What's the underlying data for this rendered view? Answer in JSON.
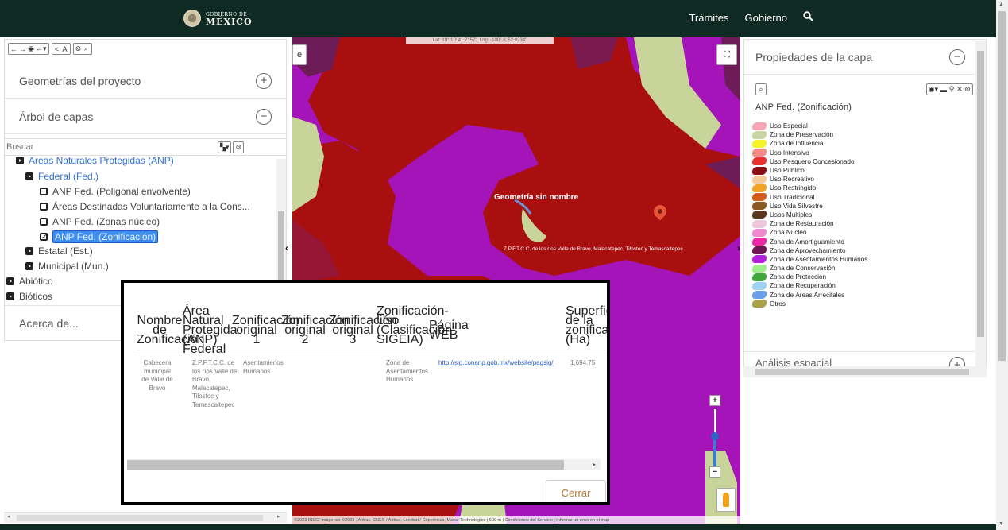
{
  "header": {
    "logo_small": "GOBIERNO DE",
    "logo_big": "MÉXICO",
    "nav": [
      "Trámites",
      "Gobierno"
    ]
  },
  "left_panel": {
    "geometrias": "Geometrías del proyecto",
    "arbol": "Árbol de capas",
    "search_placeholder": "Buscar",
    "acerca": "Acerca de...",
    "tree_top_partial": "Áreas Naturales Protegidas (ANP)",
    "tree": [
      {
        "label": "Federal (Fed.)"
      },
      {
        "label": "ANP Fed. (Poligonal envolvente)"
      },
      {
        "label": "Áreas Destinadas Voluntariamente a la Cons..."
      },
      {
        "label": "ANP Fed. (Zonas núcleo)"
      },
      {
        "label": "ANP Fed. (Zonificación)"
      },
      {
        "label": "Estatal (Est.)"
      },
      {
        "label": "Municipal (Mun.)"
      },
      {
        "label": "Abiótico"
      },
      {
        "label": "Bióticos"
      }
    ]
  },
  "map": {
    "coords": "Lat: 19° 10' 41.7157\", Lng: -100° 6' 52.0234\"",
    "geom_label": "Geometría sin nombre",
    "zone_label": "Z.P.F.T.C.C. de los ríos Valle de Bravo, Malacatepec, Tilostoc y Temascaltepec",
    "attribution": "©2023 INEGI Imágenes ©2023 , Airbus, CNES / Airbus, Landsat / Copernicus, Maxar Technologies | 500 m | Condiciones del Servicio | Informar un error en el map",
    "edge_letter": "e"
  },
  "right_panel": {
    "title": "Propiedades de la capa",
    "layer_name": "ANP Fed. (Zonificación)",
    "analisis": "Análisis espacial",
    "legend": [
      {
        "label": "Uso Especial",
        "color": "#f7a6b4"
      },
      {
        "label": "Zona de Preservación",
        "color": "#c9d6a3"
      },
      {
        "label": "Zona de Influencia",
        "color": "#f7f32a"
      },
      {
        "label": "Uso Intensivo",
        "color": "#f28a8a"
      },
      {
        "label": "Uso Pesquero Concesionado",
        "color": "#e8322c"
      },
      {
        "label": "Uso Público",
        "color": "#8b0f12"
      },
      {
        "label": "Uso Recreativo",
        "color": "#f4cc9c"
      },
      {
        "label": "Uso Restringido",
        "color": "#f2a428"
      },
      {
        "label": "Uso Tradicional",
        "color": "#d45d1a"
      },
      {
        "label": "Uso Vida Silvestre",
        "color": "#8a5a22"
      },
      {
        "label": "Usos Multiples",
        "color": "#5a3820"
      },
      {
        "label": "Zona  de Restauración",
        "color": "#f0c6dc"
      },
      {
        "label": "Zona Núcleo",
        "color": "#f08ad0"
      },
      {
        "label": "Zona de Amortiguamiento",
        "color": "#e92aa2"
      },
      {
        "label": "Zona de Aprovechamiento",
        "color": "#6e1452"
      },
      {
        "label": "Zona de Asentamientos Humanos",
        "color": "#b81ee0"
      },
      {
        "label": "Zona de Conservación",
        "color": "#9ef08a"
      },
      {
        "label": "Zona de Protección",
        "color": "#3fa83a"
      },
      {
        "label": "Zona de Recuperación",
        "color": "#9ed2f2"
      },
      {
        "label": "Zona de Áreas Arrecifales",
        "color": "#6a9ee8"
      },
      {
        "label": "Otros",
        "color": "#a8a04a"
      }
    ]
  },
  "modal": {
    "headers": [
      "Nombre de Zonificación",
      "Área Natural Protegida (ANP) Federal",
      "Zonificación original 1",
      "Zonificación original 2",
      "Zonificación original 3",
      "Zonificación-Uso (Clasificación SIGEIA)",
      "Página WEB",
      "Superficie de la zonificaci (Ha)"
    ],
    "row": [
      "Cabecera municipal de Valle de Bravo",
      "Z.P.F.T.C.C. de los ríos Valle de Bravo, Malacatepec, Tilostoc y Temascaltepec",
      "Asentamienos Humanos",
      "",
      "",
      "Zona de Asentamientos Humanos",
      "http://sig.conanp.gob.mx/website/pagsig/",
      "1,694.75"
    ],
    "close_label": "Cerrar"
  }
}
